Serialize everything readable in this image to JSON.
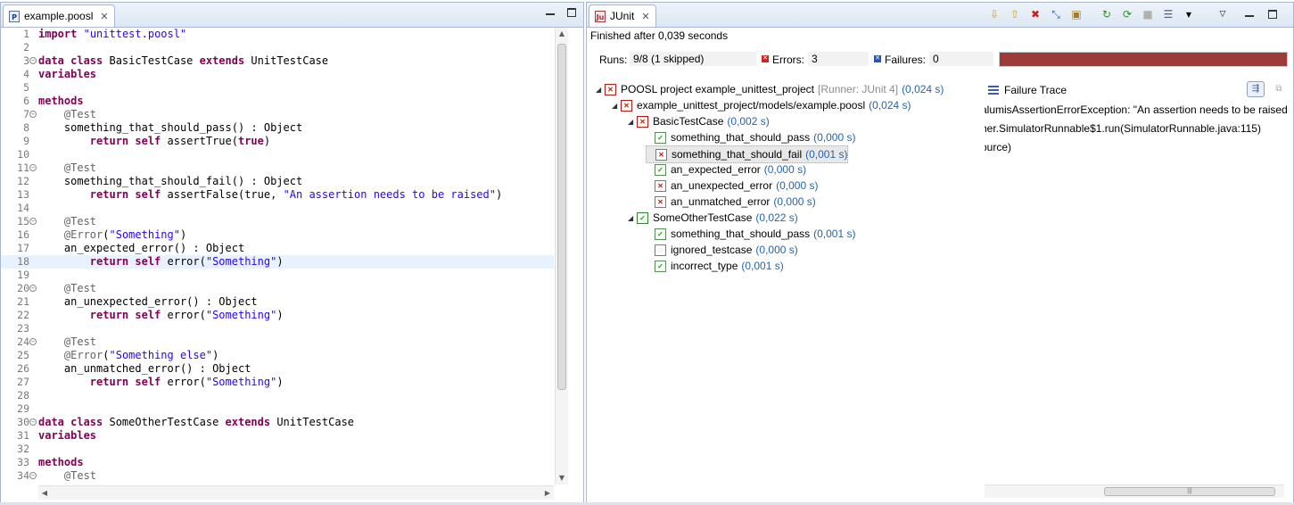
{
  "editor": {
    "tab_label": "example.poosl",
    "tab_icon_letter": "P",
    "lines": [
      {
        "n": "1",
        "fold": false,
        "tokens": [
          [
            "kw",
            "import"
          ],
          [
            "t",
            " "
          ],
          [
            "str",
            "\"unittest.poosl\""
          ]
        ]
      },
      {
        "n": "2",
        "fold": false,
        "tokens": []
      },
      {
        "n": "3",
        "fold": true,
        "tokens": [
          [
            "kw",
            "data class"
          ],
          [
            "t",
            " BasicTestCase "
          ],
          [
            "kw",
            "extends"
          ],
          [
            "t",
            " UnitTestCase"
          ]
        ]
      },
      {
        "n": "4",
        "fold": false,
        "tokens": [
          [
            "kw",
            "variables"
          ]
        ]
      },
      {
        "n": "5",
        "fold": false,
        "tokens": []
      },
      {
        "n": "6",
        "fold": false,
        "tokens": [
          [
            "kw",
            "methods"
          ]
        ]
      },
      {
        "n": "7",
        "fold": true,
        "tokens": [
          [
            "t",
            "    "
          ],
          [
            "ann",
            "@Test"
          ]
        ]
      },
      {
        "n": "8",
        "fold": false,
        "tokens": [
          [
            "t",
            "    something_that_should_pass() : Object"
          ]
        ]
      },
      {
        "n": "9",
        "fold": false,
        "tokens": [
          [
            "t",
            "        "
          ],
          [
            "kw",
            "return self"
          ],
          [
            "t",
            " assertTrue("
          ],
          [
            "kw",
            "true"
          ],
          [
            "t",
            ")"
          ]
        ]
      },
      {
        "n": "10",
        "fold": false,
        "tokens": []
      },
      {
        "n": "11",
        "fold": true,
        "tokens": [
          [
            "t",
            "    "
          ],
          [
            "ann",
            "@Test"
          ]
        ]
      },
      {
        "n": "12",
        "fold": false,
        "tokens": [
          [
            "t",
            "    something_that_should_fail() : Object"
          ]
        ]
      },
      {
        "n": "13",
        "fold": false,
        "tokens": [
          [
            "t",
            "        "
          ],
          [
            "kw",
            "return self"
          ],
          [
            "t",
            " assertFalse(true, "
          ],
          [
            "str",
            "\"An assertion needs to be raised\""
          ],
          [
            "t",
            ")"
          ]
        ]
      },
      {
        "n": "14",
        "fold": false,
        "tokens": []
      },
      {
        "n": "15",
        "fold": true,
        "tokens": [
          [
            "t",
            "    "
          ],
          [
            "ann",
            "@Test"
          ]
        ]
      },
      {
        "n": "16",
        "fold": false,
        "tokens": [
          [
            "t",
            "    "
          ],
          [
            "ann",
            "@Error"
          ],
          [
            "t",
            "("
          ],
          [
            "str",
            "\"Something\""
          ],
          [
            "t",
            ")"
          ]
        ]
      },
      {
        "n": "17",
        "fold": false,
        "tokens": [
          [
            "t",
            "    an_expected_error() : Object"
          ]
        ]
      },
      {
        "n": "18",
        "fold": false,
        "current": true,
        "tokens": [
          [
            "t",
            "        "
          ],
          [
            "kw",
            "return self"
          ],
          [
            "t",
            " error("
          ],
          [
            "str",
            "\"Something\""
          ],
          [
            "t",
            ")"
          ]
        ]
      },
      {
        "n": "19",
        "fold": false,
        "tokens": []
      },
      {
        "n": "20",
        "fold": true,
        "tokens": [
          [
            "t",
            "    "
          ],
          [
            "ann",
            "@Test"
          ]
        ]
      },
      {
        "n": "21",
        "fold": false,
        "tokens": [
          [
            "t",
            "    an_unexpected_error() : Object"
          ]
        ]
      },
      {
        "n": "22",
        "fold": false,
        "tokens": [
          [
            "t",
            "        "
          ],
          [
            "kw",
            "return self"
          ],
          [
            "t",
            " error("
          ],
          [
            "str",
            "\"Something\""
          ],
          [
            "t",
            ")"
          ]
        ]
      },
      {
        "n": "23",
        "fold": false,
        "tokens": []
      },
      {
        "n": "24",
        "fold": true,
        "tokens": [
          [
            "t",
            "    "
          ],
          [
            "ann",
            "@Test"
          ]
        ]
      },
      {
        "n": "25",
        "fold": false,
        "tokens": [
          [
            "t",
            "    "
          ],
          [
            "ann",
            "@Error"
          ],
          [
            "t",
            "("
          ],
          [
            "str",
            "\"Something else\""
          ],
          [
            "t",
            ")"
          ]
        ]
      },
      {
        "n": "26",
        "fold": false,
        "tokens": [
          [
            "t",
            "    an_unmatched_error() : Object"
          ]
        ]
      },
      {
        "n": "27",
        "fold": false,
        "tokens": [
          [
            "t",
            "        "
          ],
          [
            "kw",
            "return self"
          ],
          [
            "t",
            " error("
          ],
          [
            "str",
            "\"Something\""
          ],
          [
            "t",
            ")"
          ]
        ]
      },
      {
        "n": "28",
        "fold": false,
        "tokens": []
      },
      {
        "n": "29",
        "fold": false,
        "tokens": []
      },
      {
        "n": "30",
        "fold": true,
        "tokens": [
          [
            "kw",
            "data class"
          ],
          [
            "t",
            " SomeOtherTestCase "
          ],
          [
            "kw",
            "extends"
          ],
          [
            "t",
            " UnitTestCase"
          ]
        ]
      },
      {
        "n": "31",
        "fold": false,
        "tokens": [
          [
            "kw",
            "variables"
          ]
        ]
      },
      {
        "n": "32",
        "fold": false,
        "tokens": []
      },
      {
        "n": "33",
        "fold": false,
        "tokens": [
          [
            "kw",
            "methods"
          ]
        ]
      },
      {
        "n": "34",
        "fold": true,
        "tokens": [
          [
            "t",
            "    "
          ],
          [
            "ann",
            "@Test"
          ]
        ]
      }
    ]
  },
  "junit": {
    "tab_label": "JUnit",
    "status": "Finished after 0,039 seconds",
    "runs_label": "Runs:",
    "runs_value": "9/8 (1 skipped)",
    "errors_label": "Errors:",
    "errors_value": "3",
    "failures_label": "Failures:",
    "failures_value": "0",
    "progress_fraction": 1.0,
    "progress_color": "#9d3b3b",
    "tree": [
      {
        "level": 0,
        "twisty": "◢",
        "icon": "suite-err",
        "label": "POOSL project example_unittest_project",
        "runner": "[Runner: JUnit 4]",
        "time": "(0,024 s)"
      },
      {
        "level": 1,
        "twisty": "◢",
        "icon": "suite-err",
        "label": "example_unittest_project/models/example.poosl",
        "runner": "",
        "time": "(0,024 s)"
      },
      {
        "level": 2,
        "twisty": "◢",
        "icon": "suite-err",
        "label": "BasicTestCase",
        "runner": "",
        "time": "(0,002 s)"
      },
      {
        "level": 3,
        "twisty": "",
        "icon": "ok",
        "label": "something_that_should_pass",
        "runner": "",
        "time": "(0,000 s)"
      },
      {
        "level": 3,
        "twisty": "",
        "icon": "err",
        "label": "something_that_should_fail",
        "runner": "",
        "time": "(0,001 s)",
        "selected": true
      },
      {
        "level": 3,
        "twisty": "",
        "icon": "ok",
        "label": "an_expected_error",
        "runner": "",
        "time": "(0,000 s)"
      },
      {
        "level": 3,
        "twisty": "",
        "icon": "err",
        "label": "an_unexpected_error",
        "runner": "",
        "time": "(0,000 s)"
      },
      {
        "level": 3,
        "twisty": "",
        "icon": "err",
        "label": "an_unmatched_error",
        "runner": "",
        "time": "(0,000 s)"
      },
      {
        "level": 2,
        "twisty": "◢",
        "icon": "suite-ok",
        "label": "SomeOtherTestCase",
        "runner": "",
        "time": "(0,022 s)"
      },
      {
        "level": 3,
        "twisty": "",
        "icon": "ok",
        "label": "something_that_should_pass",
        "runner": "",
        "time": "(0,001 s)"
      },
      {
        "level": 3,
        "twisty": "",
        "icon": "ign",
        "label": "ignored_testcase",
        "runner": "",
        "time": "(0,000 s)"
      },
      {
        "level": 3,
        "twisty": "",
        "icon": "ok",
        "label": "incorrect_type",
        "runner": "",
        "time": "(0,001 s)"
      }
    ],
    "trace_title": "Failure Trace",
    "trace_lines": [
      "alumisAssertionErrorException: \"An assertion needs to be raised\"",
      "her.SimulatorRunnable$1.run(SimulatorRunnable.java:115)",
      "ource)"
    ],
    "toolbar_icons": [
      "next-failure-icon",
      "previous-failure-icon",
      "show-failures-only-icon",
      "scroll-lock-icon",
      "layout-icon",
      "rerun-icon",
      "rerun-failed-first-icon",
      "stop-icon",
      "history-icon",
      "dropdown-icon",
      "view-menu-icon",
      "minimize-icon",
      "maximize-icon"
    ]
  }
}
